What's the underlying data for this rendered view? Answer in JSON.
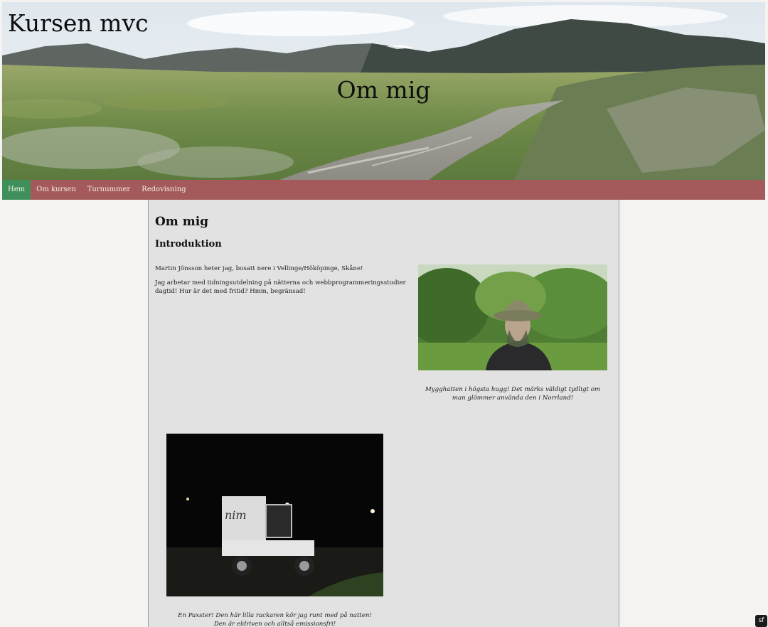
{
  "header": {
    "site_title": "Kursen mvc",
    "banner_title": "Om mig"
  },
  "nav": {
    "items": [
      {
        "label": "Hem",
        "active": true
      },
      {
        "label": "Om kursen",
        "active": false
      },
      {
        "label": "Turnummer",
        "active": false
      },
      {
        "label": "Redovisning",
        "active": false
      }
    ]
  },
  "main": {
    "title": "Om mig",
    "subtitle": "Introduktion",
    "paragraphs": [
      "Martin Jönsson heter jag, bosatt nere i Vellinge/Hököpinge, Skåne!",
      "Jag arbetar med tidningsutdelning på nätterna och webbprogrammeringsstudier dagtid! Hur är det med fritid? Hmm, begränsad!"
    ],
    "figures": [
      {
        "caption": "Mygghatten i högsta hugg! Det märks väldigt tydligt om man glömmer använda den i Norrland!"
      },
      {
        "caption": "En Paxster! Den här lilla rackaren kör jag runt med på natten! Den är eldriven och alltså emissionsfri!",
        "vehicle_text": "nim"
      }
    ]
  },
  "colors": {
    "nav_bg": "#a45a5a",
    "nav_active": "#3f8f5a",
    "content_bg": "#e2e2e2",
    "page_bg": "#f4f3f1"
  },
  "corner_badge": {
    "icon": "symfony-icon",
    "glyph": "sf"
  }
}
